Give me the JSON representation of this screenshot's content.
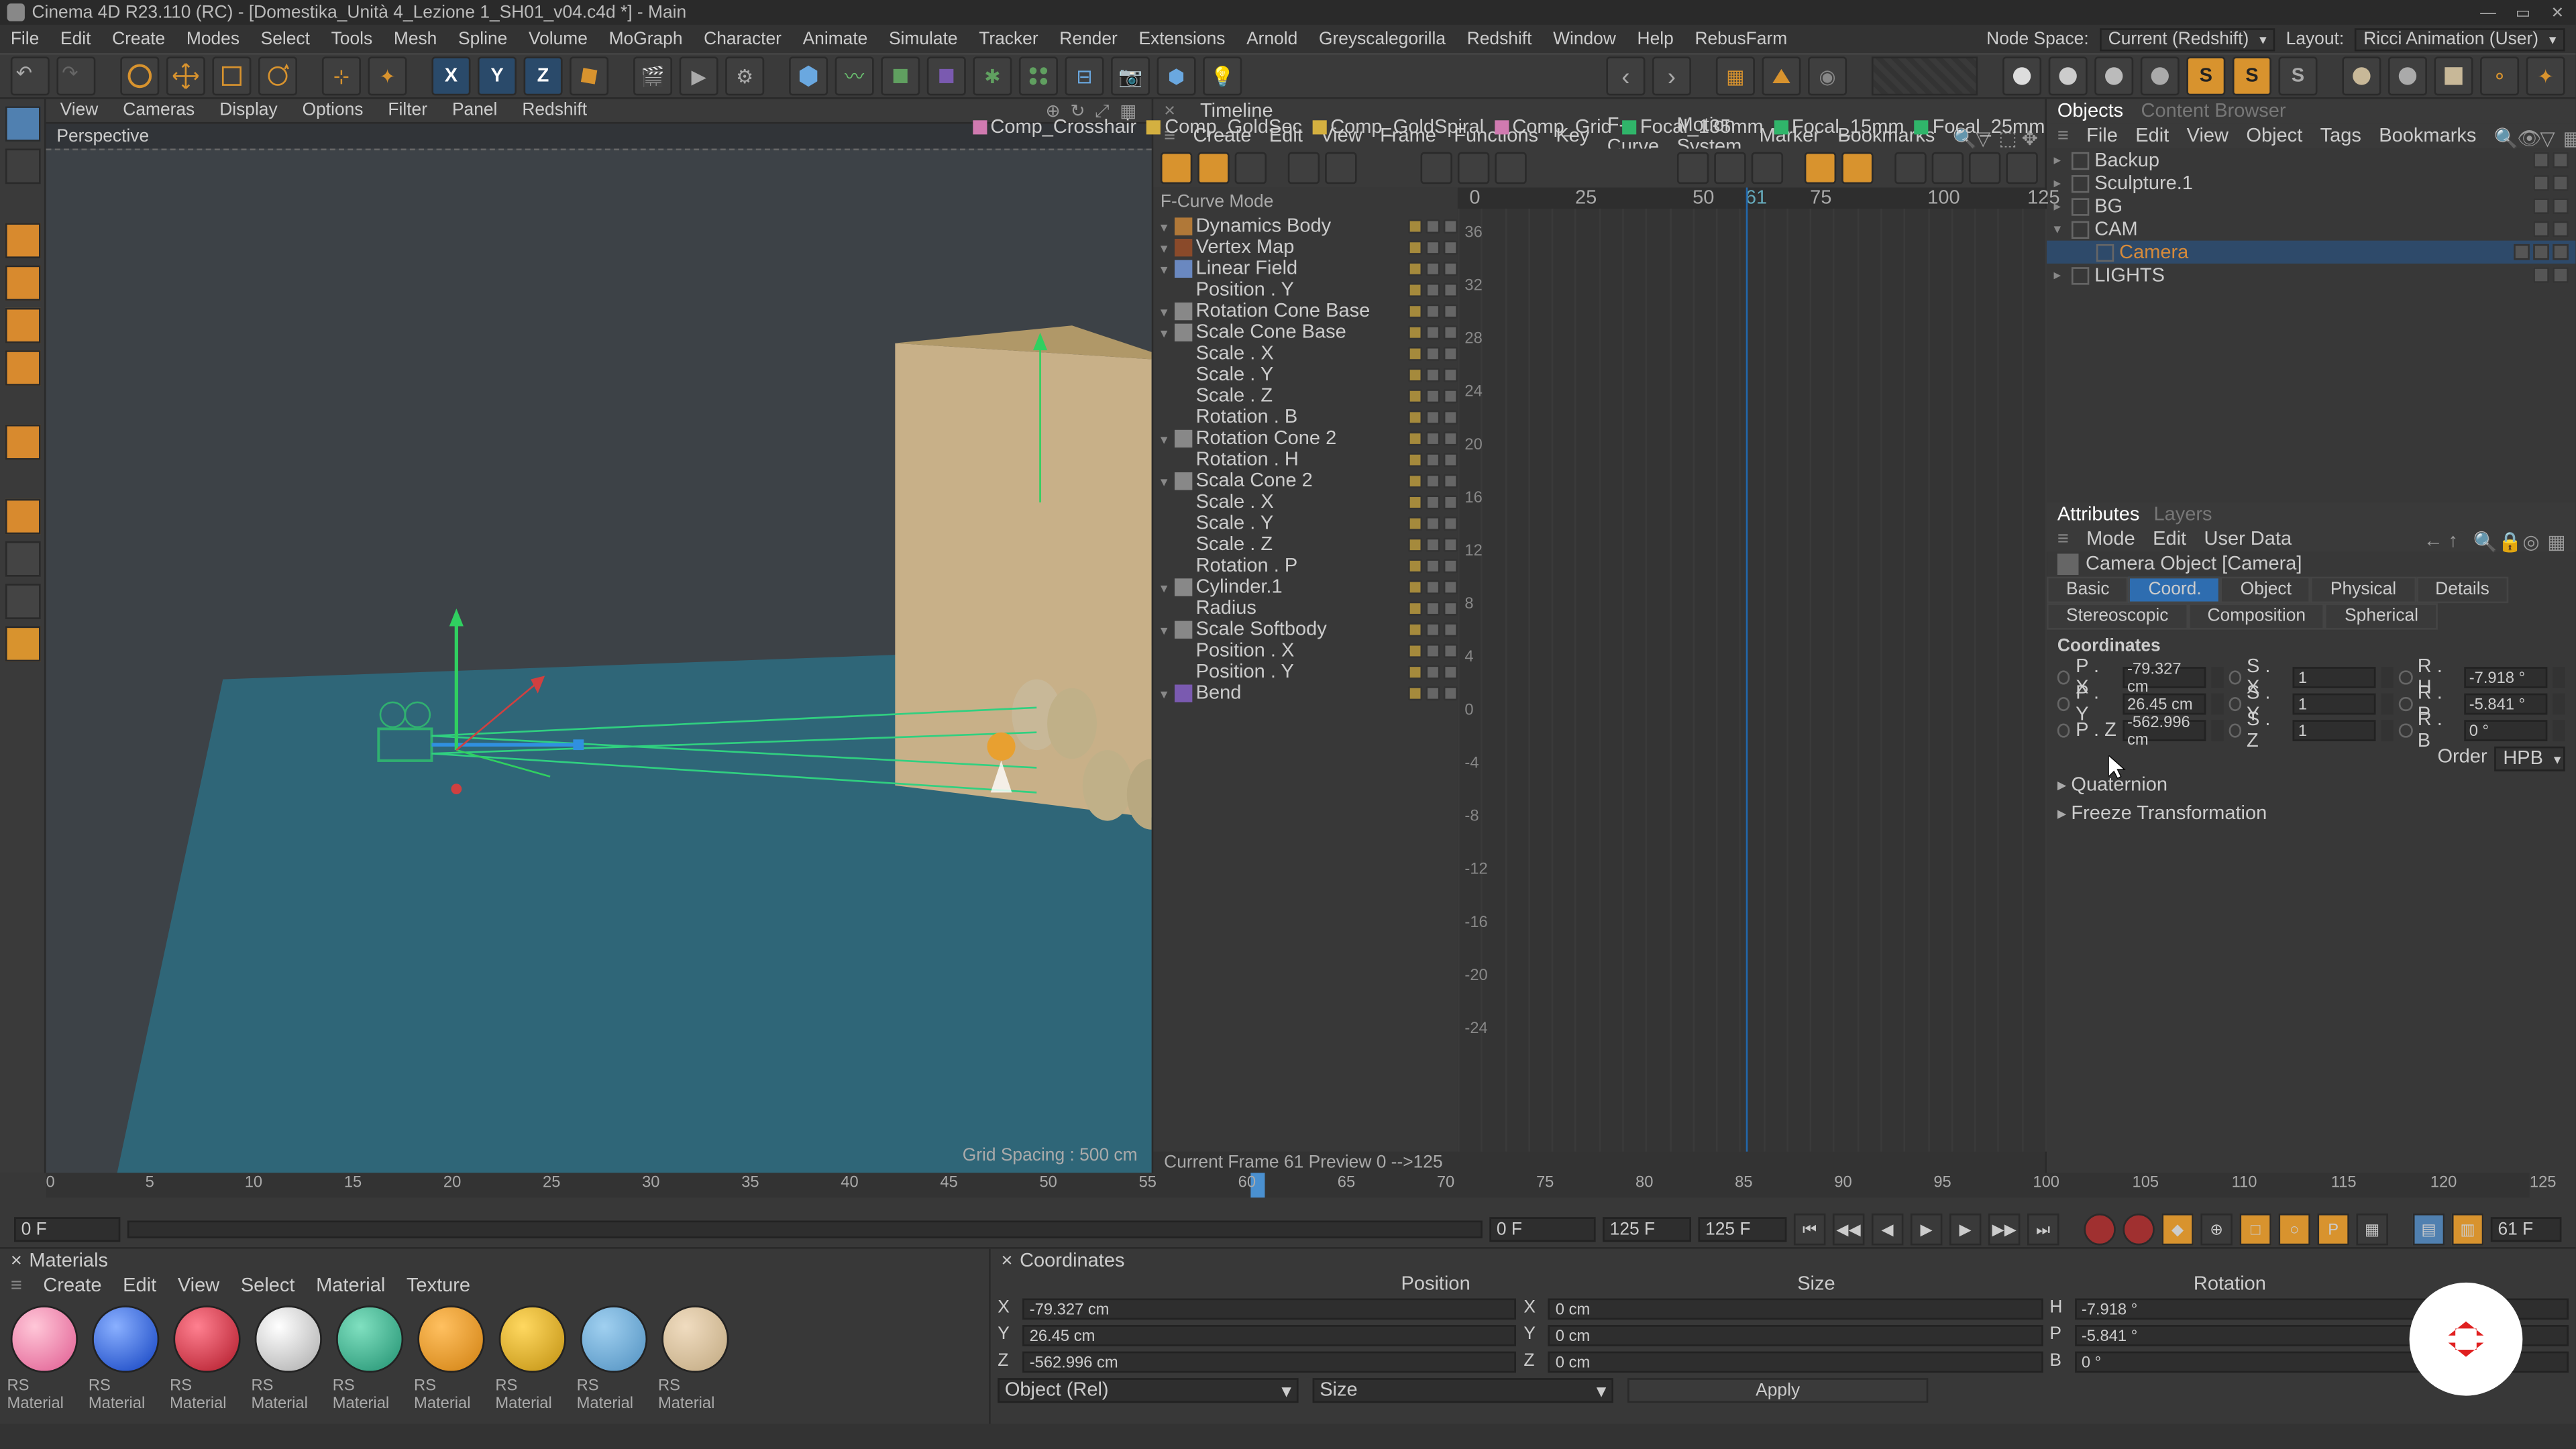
{
  "title": "Cinema 4D R23.110 (RC) - [Domestika_Unità 4_Lezione 1_SH01_v04.c4d *] - Main",
  "menubar": [
    "File",
    "Edit",
    "Create",
    "Modes",
    "Select",
    "Tools",
    "Mesh",
    "Spline",
    "Volume",
    "MoGraph",
    "Character",
    "Animate",
    "Simulate",
    "Tracker",
    "Render",
    "Extensions",
    "Arnold",
    "Greyscalegorilla",
    "Redshift",
    "Window",
    "Help",
    "RebusFarm"
  ],
  "nodeSpaceLabel": "Node Space:",
  "nodeSpaceValue": "Current (Redshift)",
  "layoutLabel": "Layout:",
  "layoutValue": "Ricci Animation (User)",
  "viewMenus": [
    "View",
    "Cameras",
    "Display",
    "Options",
    "Filter",
    "Panel",
    "Redshift"
  ],
  "viewLabel": "Perspective",
  "gridLabel": "Grid Spacing : 500 cm",
  "tags": [
    {
      "color": "#d07ab0",
      "label": "Comp_Crosshair"
    },
    {
      "color": "#d4b040",
      "label": "Comp_GoldSec"
    },
    {
      "color": "#d4b040",
      "label": "Comp_GoldSpiral"
    },
    {
      "color": "#d07ab0",
      "label": "Comp_Grid"
    },
    {
      "color": "#30b56a",
      "label": "Focal_135mm"
    },
    {
      "color": "#30b56a",
      "label": "Focal_15mm"
    },
    {
      "color": "#30b56a",
      "label": "Focal_25mm"
    }
  ],
  "timeline": {
    "tab": "Timeline",
    "menus": [
      "Create",
      "Edit",
      "View",
      "Frame",
      "Functions",
      "Key",
      "F-Curve",
      "Motion System",
      "Marker",
      "Bookmarks"
    ],
    "mode": "F-Curve Mode",
    "rulerTicks": [
      "0",
      "25",
      "50",
      "61",
      "75",
      "100",
      "125"
    ],
    "yTicks": [
      "36",
      "32",
      "28",
      "24",
      "20",
      "16",
      "12",
      "8",
      "4",
      "0",
      "-4",
      "-8",
      "-12",
      "-16",
      "-20",
      "-24"
    ],
    "tracks": [
      {
        "indent": 0,
        "name": "Dynamics Body",
        "icon": "#b07838"
      },
      {
        "indent": 0,
        "name": "Vertex Map",
        "icon": "#8a4a2a"
      },
      {
        "indent": 0,
        "name": "Linear Field",
        "icon": "#6a88c0"
      },
      {
        "indent": 1,
        "name": "Position . Y"
      },
      {
        "indent": 0,
        "name": "Rotation Cone Base",
        "icon": "#888"
      },
      {
        "indent": 0,
        "name": "Scale Cone Base",
        "icon": "#888"
      },
      {
        "indent": 1,
        "name": "Scale . X"
      },
      {
        "indent": 1,
        "name": "Scale . Y"
      },
      {
        "indent": 1,
        "name": "Scale . Z"
      },
      {
        "indent": 1,
        "name": "Rotation . B"
      },
      {
        "indent": 0,
        "name": "Rotation Cone 2",
        "icon": "#888"
      },
      {
        "indent": 1,
        "name": "Rotation . H"
      },
      {
        "indent": 0,
        "name": "Scala Cone 2",
        "icon": "#888"
      },
      {
        "indent": 1,
        "name": "Scale . X"
      },
      {
        "indent": 1,
        "name": "Scale . Y"
      },
      {
        "indent": 1,
        "name": "Scale . Z"
      },
      {
        "indent": 1,
        "name": "Rotation . P"
      },
      {
        "indent": 0,
        "name": "Cylinder.1",
        "icon": "#888"
      },
      {
        "indent": 1,
        "name": "Radius"
      },
      {
        "indent": 0,
        "name": "Scale Softbody",
        "icon": "#888"
      },
      {
        "indent": 1,
        "name": "Position . X"
      },
      {
        "indent": 1,
        "name": "Position . Y"
      },
      {
        "indent": 0,
        "name": "Bend",
        "icon": "#7a5ab0"
      }
    ],
    "footer": "Current Frame  61  Preview  0 -->125"
  },
  "objects": {
    "tab": "Objects",
    "tab2": "Content Browser",
    "menus": [
      "File",
      "Edit",
      "View",
      "Object",
      "Tags",
      "Bookmarks"
    ],
    "tree": [
      {
        "name": "Backup",
        "indent": 0,
        "caret": "▸"
      },
      {
        "name": "Sculpture.1",
        "indent": 0,
        "caret": "▸"
      },
      {
        "name": "BG",
        "indent": 0,
        "caret": "▸"
      },
      {
        "name": "CAM",
        "indent": 0,
        "caret": "▾",
        "sel": false
      },
      {
        "name": "Camera",
        "indent": 1,
        "caret": "",
        "sel": true
      },
      {
        "name": "LIGHTS",
        "indent": 0,
        "caret": "▸"
      }
    ]
  },
  "attributes": {
    "tab1": "Attributes",
    "tab2": "Layers",
    "menus": [
      "Mode",
      "Edit",
      "User Data"
    ],
    "title": "Camera Object [Camera]",
    "tabs": [
      "Basic",
      "Coord.",
      "Object",
      "Physical",
      "Details",
      "Stereoscopic",
      "Composition",
      "Spherical"
    ],
    "activeTab": "Coord.",
    "section": "Coordinates",
    "rows": [
      {
        "p": "P . X",
        "pv": "-79.327 cm",
        "s": "S . X",
        "sv": "1",
        "r": "R . H",
        "rv": "-7.918 °"
      },
      {
        "p": "P . Y",
        "pv": "26.45 cm",
        "s": "S . Y",
        "sv": "1",
        "r": "R . P",
        "rv": "-5.841 °"
      },
      {
        "p": "P . Z",
        "pv": "-562.996 cm",
        "s": "S . Z",
        "sv": "1",
        "r": "R . B",
        "rv": "0 °"
      }
    ],
    "orderLabel": "Order",
    "orderValue": "HPB",
    "expanders": [
      "Quaternion",
      "Freeze Transformation"
    ]
  },
  "mainRuler": {
    "ticks": [
      "0",
      "5",
      "10",
      "15",
      "20",
      "25",
      "30",
      "35",
      "40",
      "45",
      "50",
      "55",
      "60",
      "65",
      "70",
      "75",
      "80",
      "85",
      "90",
      "95",
      "100",
      "105",
      "110",
      "115",
      "120",
      "125"
    ],
    "startFrame": "0 F",
    "endFrame": "0 F",
    "playEnd1": "125 F",
    "playEnd2": "125 F",
    "current": "61 F"
  },
  "materials": {
    "tab": "Materials",
    "menus": [
      "Create",
      "Edit",
      "View",
      "Select",
      "Material",
      "Texture"
    ],
    "items": [
      {
        "bg": "radial-gradient(circle at 35% 30%,#ffc7d8,#e05a90)"
      },
      {
        "bg": "radial-gradient(circle at 35% 30%,#8ab0ff,#1040c0)"
      },
      {
        "bg": "radial-gradient(circle at 35% 30%,#ff8090,#b01828)"
      },
      {
        "bg": "radial-gradient(circle at 35% 30%,#fff,#aaa)"
      },
      {
        "bg": "radial-gradient(circle at 35% 30%,#80e0c0,#209070)"
      },
      {
        "bg": "radial-gradient(circle at 35% 30%,#ffc060,#d08010)"
      },
      {
        "bg": "radial-gradient(circle at 35% 30%,#ffd860,#c09010)"
      },
      {
        "bg": "radial-gradient(circle at 35% 30%,#a0d0f0,#5090c0)"
      },
      {
        "bg": "radial-gradient(circle at 35% 30%,#f0dcc0,#c0a880)"
      }
    ],
    "label": "RS Material"
  },
  "coordPanel": {
    "tab": "Coordinates",
    "headers": [
      "Position",
      "Size",
      "Rotation"
    ],
    "rows": [
      {
        "axis": "X",
        "p": "-79.327 cm",
        "s": "0 cm",
        "r": "-7.918 °",
        "rl": "H"
      },
      {
        "axis": "Y",
        "p": "26.45 cm",
        "s": "0 cm",
        "r": "-5.841 °",
        "rl": "P"
      },
      {
        "axis": "Z",
        "p": "-562.996 cm",
        "s": "0 cm",
        "r": "0 °",
        "rl": "B"
      }
    ],
    "sel1": "Object (Rel)",
    "sel2": "Size",
    "apply": "Apply"
  }
}
